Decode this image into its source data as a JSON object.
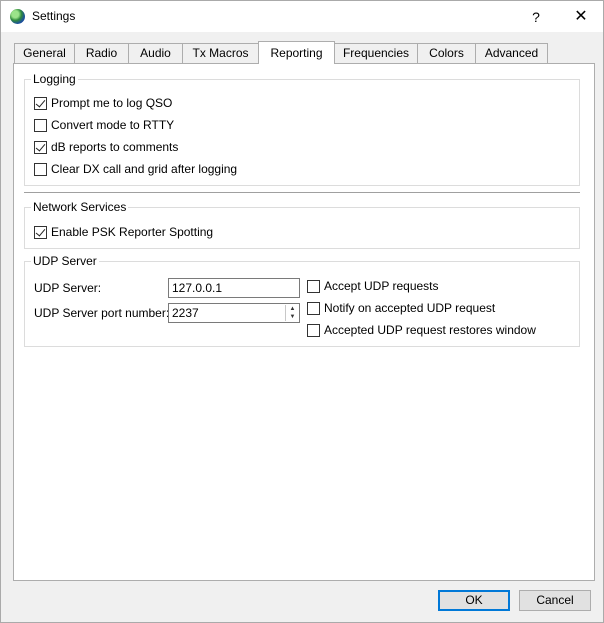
{
  "window": {
    "title": "Settings",
    "help_label": "?",
    "close_label": "✕"
  },
  "tabs": [
    {
      "label": "General"
    },
    {
      "label": "Radio"
    },
    {
      "label": "Audio"
    },
    {
      "label": "Tx Macros"
    },
    {
      "label": "Reporting",
      "active": true
    },
    {
      "label": "Frequencies"
    },
    {
      "label": "Colors"
    },
    {
      "label": "Advanced"
    }
  ],
  "logging": {
    "legend": "Logging",
    "options": [
      {
        "label": "Prompt me to log QSO",
        "checked": true
      },
      {
        "label": "Convert mode to RTTY",
        "checked": false
      },
      {
        "label": "dB reports to comments",
        "checked": true
      },
      {
        "label": "Clear DX call and grid after logging",
        "checked": false
      }
    ]
  },
  "network": {
    "legend": "Network Services",
    "psk_label": "Enable PSK Reporter Spotting",
    "psk_checked": true
  },
  "udp": {
    "legend": "UDP Server",
    "server_label": "UDP Server:",
    "server_value": "127.0.0.1",
    "port_label": "UDP Server port number:",
    "port_value": "2237",
    "options": [
      {
        "label": "Accept UDP requests",
        "checked": false
      },
      {
        "label": "Notify on accepted UDP request",
        "checked": false
      },
      {
        "label": "Accepted UDP request restores window",
        "checked": false
      }
    ]
  },
  "buttons": {
    "ok": "OK",
    "cancel": "Cancel"
  }
}
